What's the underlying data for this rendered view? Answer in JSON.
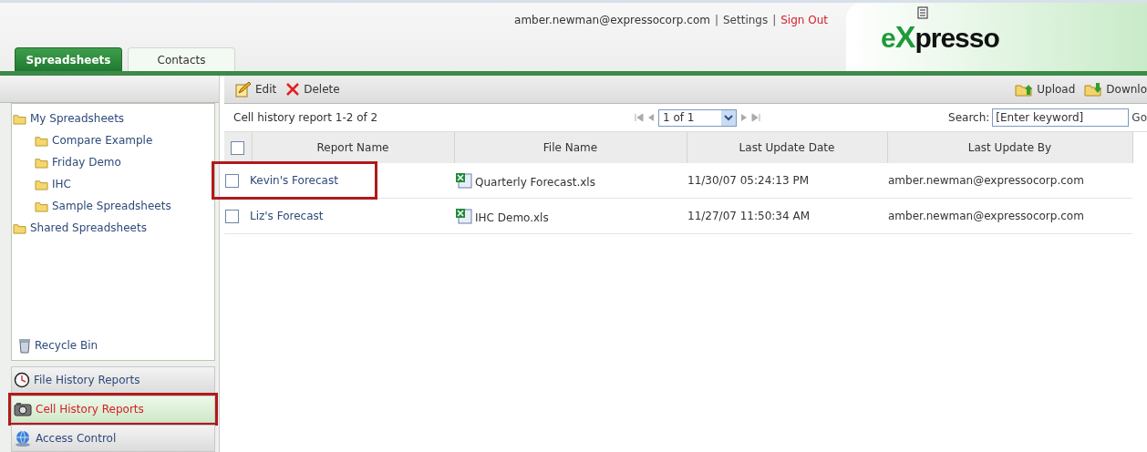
{
  "header": {
    "user": "amber.newman@expressocorp.com",
    "separator": "|",
    "settings": "Settings",
    "sign_out": "Sign Out",
    "logo_parts": [
      "e",
      "X",
      "presso"
    ]
  },
  "tabs": [
    {
      "label": "Spreadsheets",
      "selected": true
    },
    {
      "label": "Contacts",
      "selected": false
    }
  ],
  "sidebar": {
    "tree": [
      {
        "label": "My Spreadsheets",
        "children": [
          {
            "label": "Compare Example"
          },
          {
            "label": "Friday Demo"
          },
          {
            "label": "IHC"
          },
          {
            "label": "Sample Spreadsheets"
          }
        ]
      },
      {
        "label": "Shared Spreadsheets"
      }
    ],
    "recycle_bin": "Recycle Bin",
    "nav": [
      {
        "label": "File History Reports",
        "kind": "clock",
        "selected": false,
        "highlighted": false
      },
      {
        "label": "Cell History Reports",
        "kind": "camera",
        "selected": true,
        "highlighted": true
      },
      {
        "label": "Access Control",
        "kind": "globe",
        "selected": false,
        "highlighted": false
      }
    ]
  },
  "toolbar": {
    "left": [
      {
        "label": "Edit",
        "kind": "edit"
      },
      {
        "label": "Delete",
        "kind": "delete"
      }
    ],
    "right": [
      {
        "label": "Upload",
        "kind": "upload"
      },
      {
        "label": "Downlo",
        "kind": "download"
      }
    ]
  },
  "grid": {
    "info": "Cell history report 1-2 of 2",
    "page": "1 of 1",
    "search_label": "Search:",
    "search_placeholder": "[Enter keyword]",
    "go": "Go",
    "select_all_checked": false,
    "columns": [
      "Report Name",
      "File Name",
      "Last Update Date",
      "Last Update By"
    ],
    "rows": [
      {
        "checked": false,
        "highlighted": true,
        "report": "Kevin's Forecast",
        "file": "Quarterly Forecast.xls",
        "date": "11/30/07 05:24:13 PM",
        "by": "amber.newman@expressocorp.com"
      },
      {
        "checked": false,
        "highlighted": false,
        "report": "Liz's Forecast",
        "file": "IHC Demo.xls",
        "date": "11/27/07 11:50:34 AM",
        "by": "amber.newman@expressocorp.com"
      }
    ]
  }
}
